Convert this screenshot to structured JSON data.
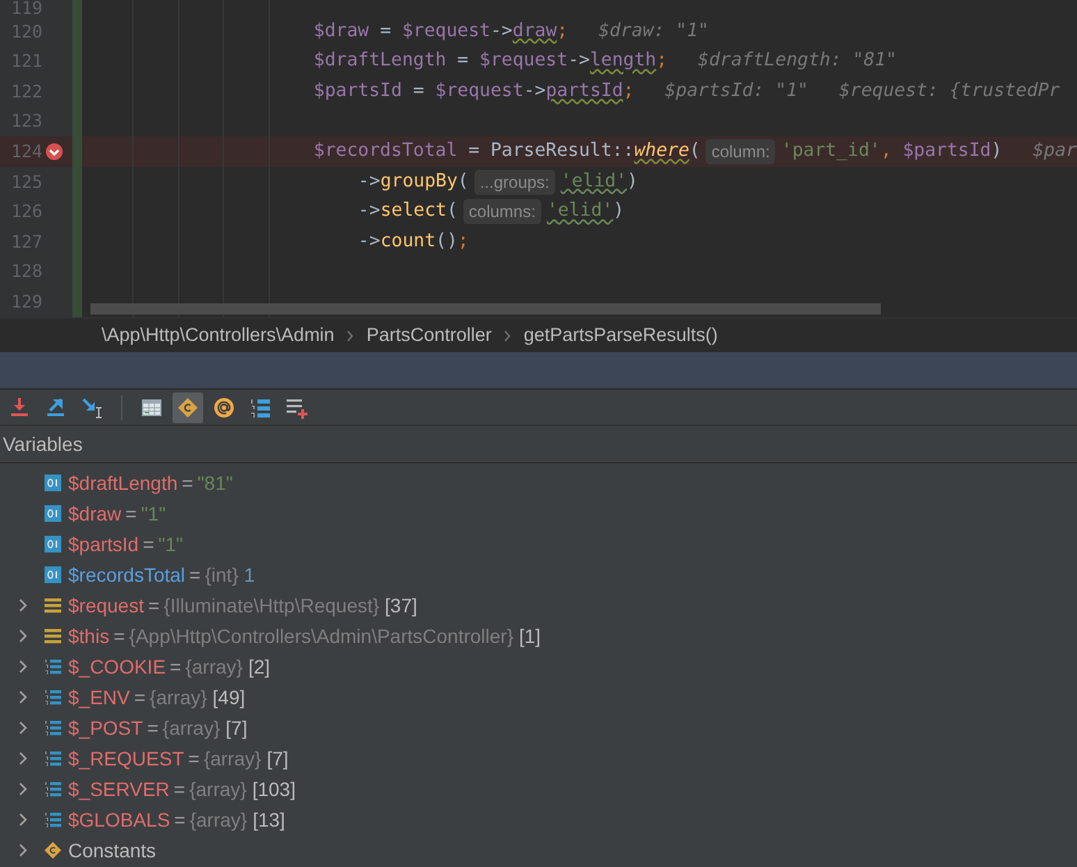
{
  "editor": {
    "lines": [
      {
        "number": "119",
        "kind": "blank",
        "breakpoint": false,
        "highlighted": false
      },
      {
        "number": "120",
        "kind": "statement",
        "breakpoint": false,
        "highlighted": false,
        "tokens": [
          {
            "kind": "var",
            "text": "$draw"
          },
          {
            "kind": "plain",
            "text": " = "
          },
          {
            "kind": "var",
            "text": "$request"
          },
          {
            "kind": "plain",
            "text": "->"
          },
          {
            "kind": "field",
            "text": "draw"
          },
          {
            "kind": "punct",
            "text": ";"
          },
          {
            "kind": "inline",
            "text": "$draw: \"1\""
          }
        ]
      },
      {
        "number": "121",
        "kind": "statement",
        "breakpoint": false,
        "highlighted": false,
        "tokens": [
          {
            "kind": "var",
            "text": "$draftLength"
          },
          {
            "kind": "plain",
            "text": " = "
          },
          {
            "kind": "var",
            "text": "$request"
          },
          {
            "kind": "plain",
            "text": "->"
          },
          {
            "kind": "field",
            "text": "length"
          },
          {
            "kind": "punct",
            "text": ";"
          },
          {
            "kind": "inline",
            "text": "$draftLength: \"81\""
          }
        ]
      },
      {
        "number": "122",
        "kind": "statement",
        "breakpoint": false,
        "highlighted": false,
        "tokens": [
          {
            "kind": "var",
            "text": "$partsId"
          },
          {
            "kind": "plain",
            "text": " = "
          },
          {
            "kind": "var",
            "text": "$request"
          },
          {
            "kind": "plain",
            "text": "->"
          },
          {
            "kind": "field",
            "text": "partsId"
          },
          {
            "kind": "punct",
            "text": ";"
          },
          {
            "kind": "inline",
            "text": "$partsId: \"1\""
          },
          {
            "kind": "inline",
            "text": "$request: {trustedPr"
          }
        ]
      },
      {
        "number": "123",
        "kind": "blank",
        "breakpoint": false,
        "highlighted": false
      },
      {
        "number": "124",
        "kind": "statement",
        "breakpoint": true,
        "highlighted": true,
        "tokens": [
          {
            "kind": "var",
            "text": "$recordsTotal"
          },
          {
            "kind": "plain",
            "text": " = ParseResult::"
          },
          {
            "kind": "static_call",
            "text": "where"
          },
          {
            "kind": "plain",
            "text": "("
          },
          {
            "kind": "hint",
            "text": "column:"
          },
          {
            "kind": "string",
            "text": "'part_id'"
          },
          {
            "kind": "punct",
            "text": ", "
          },
          {
            "kind": "var",
            "text": "$partsId"
          },
          {
            "kind": "plain",
            "text": ")"
          },
          {
            "kind": "inline",
            "text": "$par"
          }
        ]
      },
      {
        "number": "125",
        "kind": "continuation",
        "breakpoint": false,
        "highlighted": false,
        "tokens": [
          {
            "kind": "plain",
            "text": "->"
          },
          {
            "kind": "method",
            "text": "groupBy"
          },
          {
            "kind": "plain",
            "text": "("
          },
          {
            "kind": "hint",
            "text": "...groups:"
          },
          {
            "kind": "string_typo",
            "text": "'elid'"
          },
          {
            "kind": "plain",
            "text": ")"
          }
        ]
      },
      {
        "number": "126",
        "kind": "continuation",
        "breakpoint": false,
        "highlighted": false,
        "tokens": [
          {
            "kind": "plain",
            "text": "->"
          },
          {
            "kind": "method",
            "text": "select"
          },
          {
            "kind": "plain",
            "text": "("
          },
          {
            "kind": "hint",
            "text": "columns:"
          },
          {
            "kind": "string_typo",
            "text": "'elid'"
          },
          {
            "kind": "plain",
            "text": ")"
          }
        ]
      },
      {
        "number": "127",
        "kind": "continuation",
        "breakpoint": false,
        "highlighted": false,
        "tokens": [
          {
            "kind": "plain",
            "text": "->"
          },
          {
            "kind": "method",
            "text": "count"
          },
          {
            "kind": "plain",
            "text": "()"
          },
          {
            "kind": "punct",
            "text": ";"
          }
        ]
      },
      {
        "number": "128",
        "kind": "blank",
        "breakpoint": false,
        "highlighted": false
      },
      {
        "number": "129",
        "kind": "blank",
        "breakpoint": false,
        "highlighted": false
      }
    ]
  },
  "breadcrumbs": [
    "\\App\\Http\\Controllers\\Admin",
    "PartsController",
    "getPartsParseResults()"
  ],
  "toolbar": [
    {
      "kind": "step_into",
      "selected": false
    },
    {
      "kind": "step_out",
      "selected": false
    },
    {
      "kind": "run_to_cursor",
      "selected": false
    },
    {
      "kind": "separator",
      "selected": false
    },
    {
      "kind": "evaluate",
      "selected": false
    },
    {
      "kind": "constants",
      "selected": true
    },
    {
      "kind": "at",
      "selected": false
    },
    {
      "kind": "numbered_list",
      "selected": false
    },
    {
      "kind": "add_watch",
      "selected": false
    }
  ],
  "variables": {
    "title": "Variables",
    "items": [
      {
        "kind": "scalar",
        "name": "$draftLength",
        "equals": "=",
        "value": "\"81\"",
        "changed": false
      },
      {
        "kind": "scalar",
        "name": "$draw",
        "equals": "=",
        "value": "\"1\"",
        "changed": false
      },
      {
        "kind": "scalar",
        "name": "$partsId",
        "equals": "=",
        "value": "\"1\"",
        "changed": false
      },
      {
        "kind": "scalar_typed",
        "name": "$recordsTotal",
        "equals": "=",
        "type": "{int}",
        "value": "1",
        "changed": true
      },
      {
        "kind": "object",
        "name": "$request",
        "equals": "=",
        "type": "{Illuminate\\Http\\Request}",
        "value": "[37]",
        "changed": false
      },
      {
        "kind": "object",
        "name": "$this",
        "equals": "=",
        "type": "{App\\Http\\Controllers\\Admin\\PartsController}",
        "value": "[1]",
        "changed": false
      },
      {
        "kind": "array",
        "name": "$_COOKIE",
        "equals": "=",
        "type": "{array}",
        "value": "[2]",
        "changed": false
      },
      {
        "kind": "array",
        "name": "$_ENV",
        "equals": "=",
        "type": "{array}",
        "value": "[49]",
        "changed": false
      },
      {
        "kind": "array",
        "name": "$_POST",
        "equals": "=",
        "type": "{array}",
        "value": "[7]",
        "changed": false
      },
      {
        "kind": "array",
        "name": "$_REQUEST",
        "equals": "=",
        "type": "{array}",
        "value": "[7]",
        "changed": false
      },
      {
        "kind": "array",
        "name": "$_SERVER",
        "equals": "=",
        "type": "{array}",
        "value": "[103]",
        "changed": false
      },
      {
        "kind": "array",
        "name": "$GLOBALS",
        "equals": "=",
        "type": "{array}",
        "value": "[13]",
        "changed": false
      },
      {
        "kind": "constants",
        "name": "Constants",
        "changed": false
      }
    ]
  }
}
